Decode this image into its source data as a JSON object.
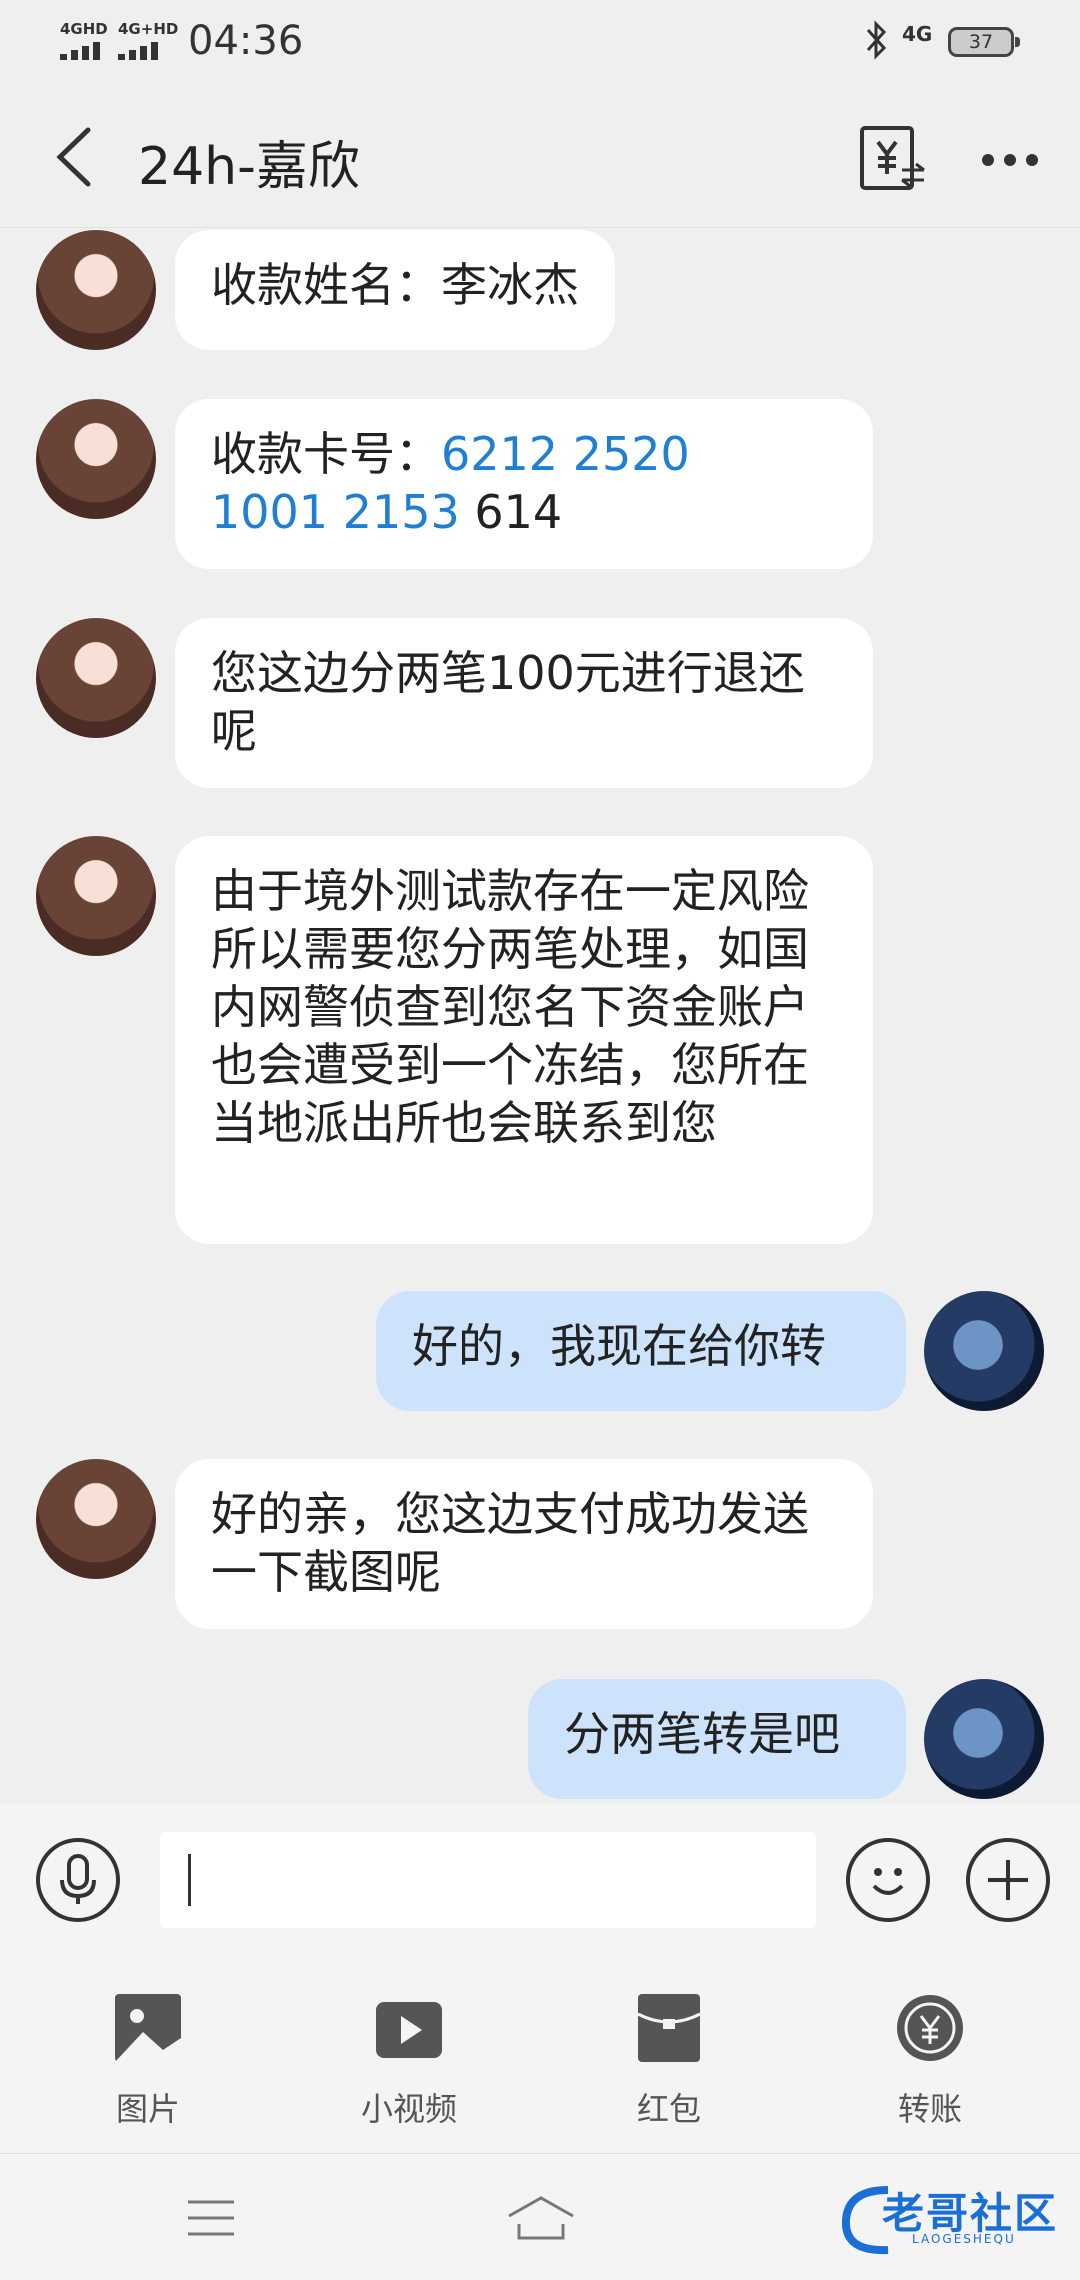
{
  "status_bar": {
    "signal1": "4GHD",
    "signal2": "4G+HD",
    "time": "04:36",
    "network": "4G",
    "battery": "37"
  },
  "header": {
    "title": "24h-嘉欣",
    "back_icon": "chevron-left-icon",
    "transfer_icon": "yuan-transfer-icon",
    "more_icon": "more-dots-icon"
  },
  "messages": [
    {
      "from": "her",
      "parts": [
        "收款姓名：李冰杰"
      ]
    },
    {
      "from": "her",
      "prefix": "收款卡号：",
      "card_line1": "6212 2520",
      "card_line2": "1001 2153",
      "card_tail": " 614"
    },
    {
      "from": "her",
      "text": "您这边分两笔100元进行退还呢"
    },
    {
      "from": "her",
      "text": "由于境外测试款存在一定风险所以需要您分两笔处理，如国内网警侦查到您名下资金账户也会遭受到一个冻结，您所在当地派出所也会联系到您"
    },
    {
      "from": "me",
      "text": "好的，我现在给你转"
    },
    {
      "from": "her",
      "text": "好的亲，您这边支付成功发送一下截图呢"
    },
    {
      "from": "me",
      "text": "分两笔转是吧"
    }
  ],
  "input": {
    "voice_icon": "microphone-icon",
    "emoji_icon": "smiley-icon",
    "plus_icon": "plus-icon",
    "value": ""
  },
  "tools": [
    {
      "label": "图片",
      "icon": "image-icon"
    },
    {
      "label": "小视频",
      "icon": "video-icon"
    },
    {
      "label": "红包",
      "icon": "red-packet-icon"
    },
    {
      "label": "转账",
      "icon": "transfer-icon"
    }
  ],
  "nav": {
    "watermark": "老哥社区",
    "watermark_sub": "LAOGESHEQU"
  },
  "colors": {
    "bubble_me": "#cde3fb",
    "bubble_her": "#ffffff",
    "link": "#1e7fd4",
    "background": "#efefef"
  }
}
